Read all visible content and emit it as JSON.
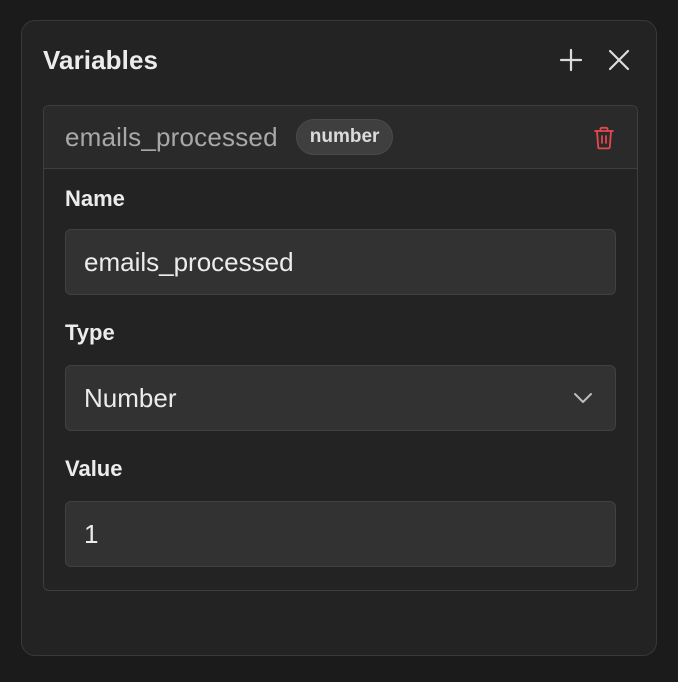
{
  "panel": {
    "title": "Variables",
    "add_icon": "plus-icon",
    "close_icon": "close-icon"
  },
  "variable": {
    "name": "emails_processed",
    "type_badge": "number",
    "delete_icon": "trash-icon",
    "delete_color": "#e5484d",
    "fields": {
      "name_label": "Name",
      "name_value": "emails_processed",
      "type_label": "Type",
      "type_value": "Number",
      "value_label": "Value",
      "value_value": "1"
    }
  }
}
